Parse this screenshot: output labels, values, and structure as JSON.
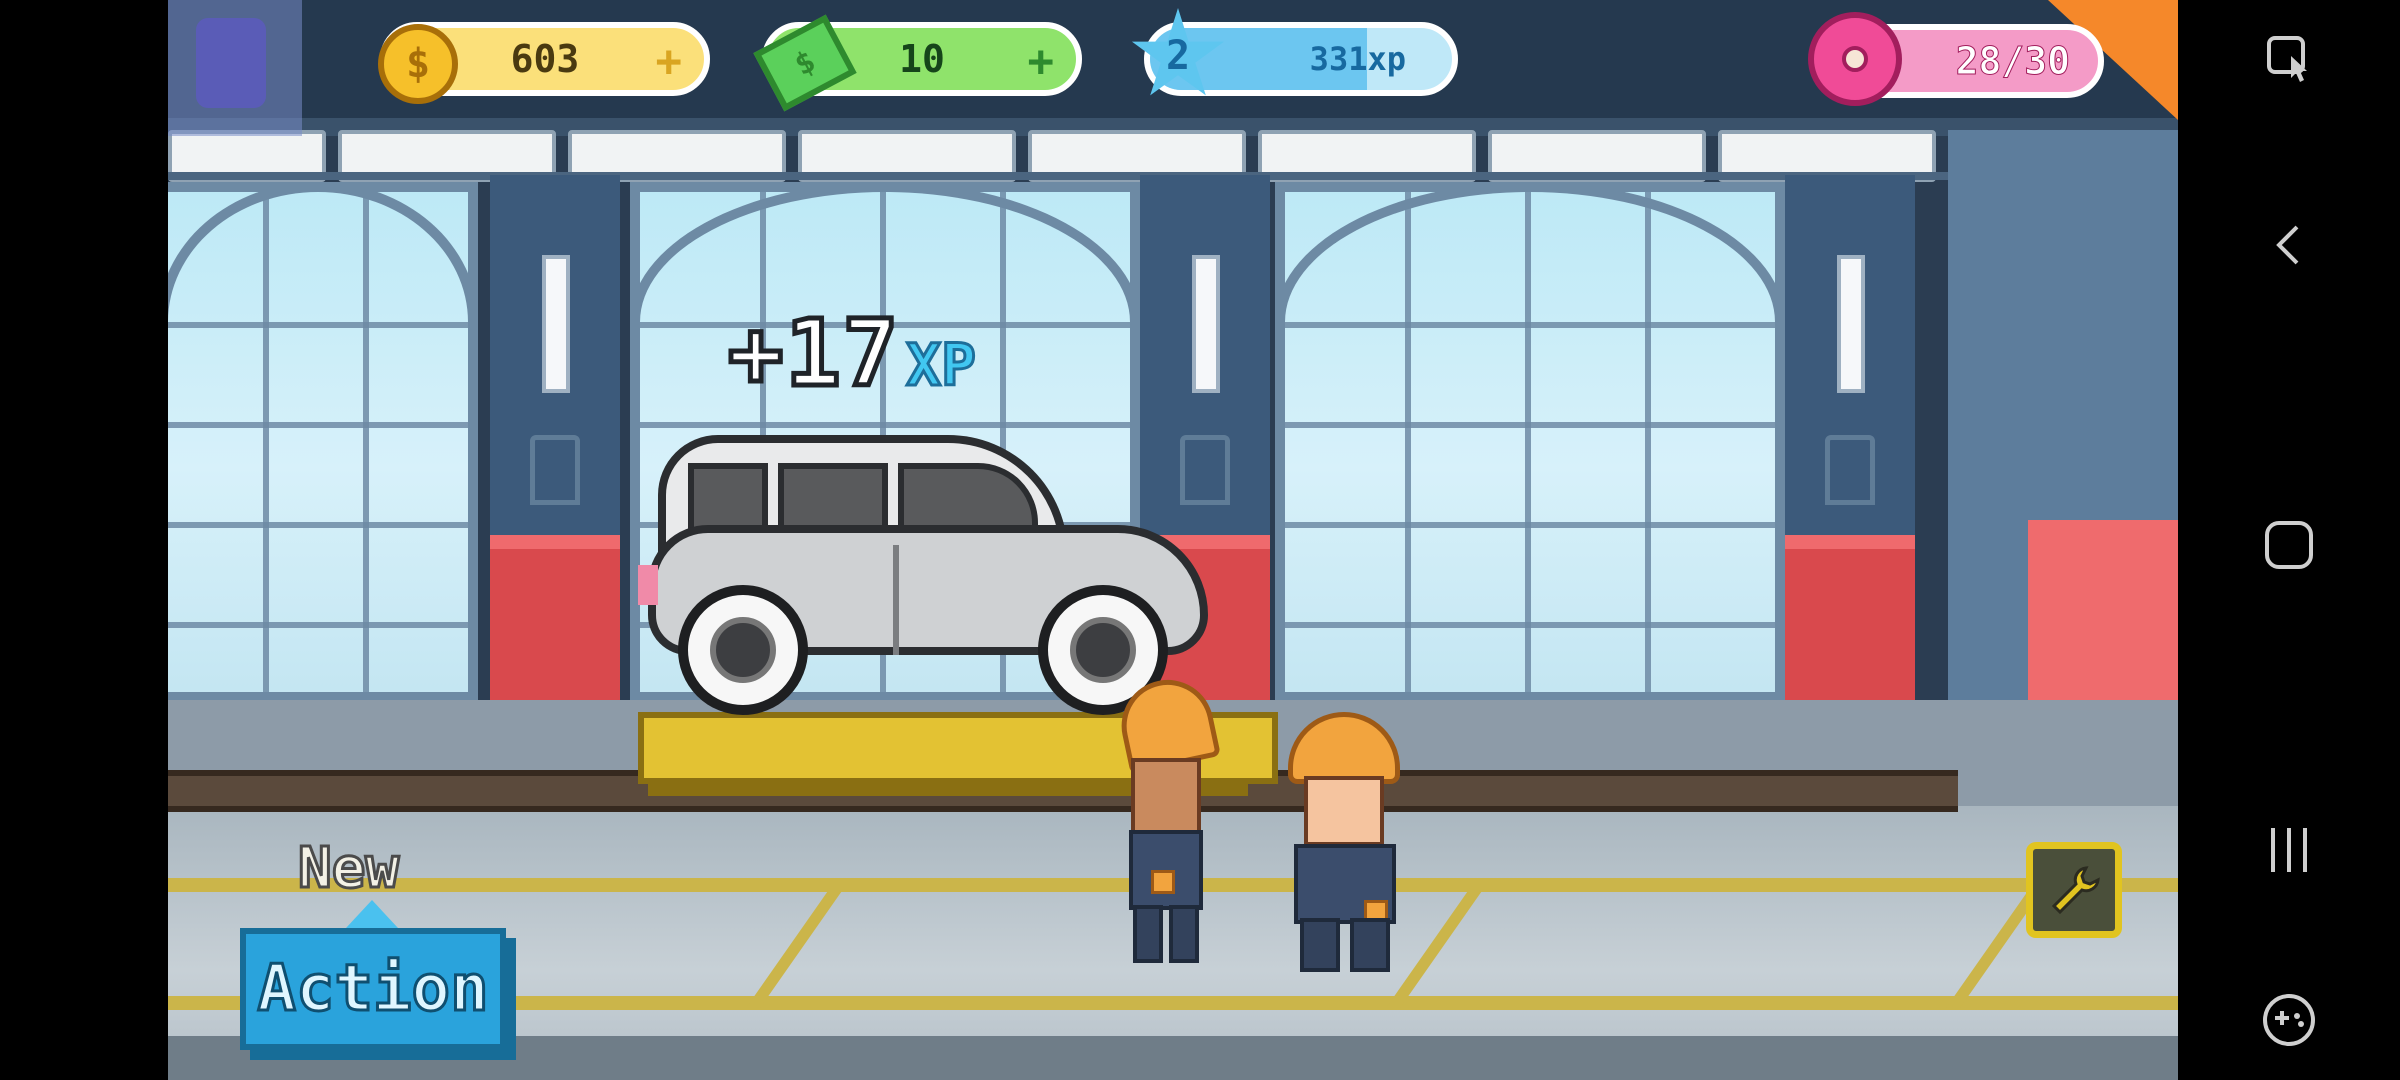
{
  "hud": {
    "coins": "603",
    "cash": "10",
    "level": "2",
    "xp": "331xp",
    "xp_fill_percent": 72,
    "donuts": "28/30",
    "plus_glyph": "+"
  },
  "popup": {
    "xp_value": "+17",
    "xp_unit": "XP"
  },
  "action": {
    "new_label": "New",
    "button_label": "Action"
  },
  "icons": {
    "coin": "coin-icon",
    "cash": "cash-icon",
    "level": "level-star-icon",
    "donut": "donut-icon",
    "tool": "wrench-icon",
    "nav_assist": "screen-assist-icon",
    "nav_back": "back-icon",
    "nav_home": "home-icon",
    "nav_recents": "recents-icon",
    "nav_game": "game-controller-icon"
  },
  "colors": {
    "coin_pill": "#fbe07a",
    "cash_pill": "#8fe36b",
    "xp_pill": "#7fd2f5",
    "donut_pill": "#f49bc7",
    "action_blue": "#2aa3dc",
    "tool_gold": "#e1c420"
  }
}
